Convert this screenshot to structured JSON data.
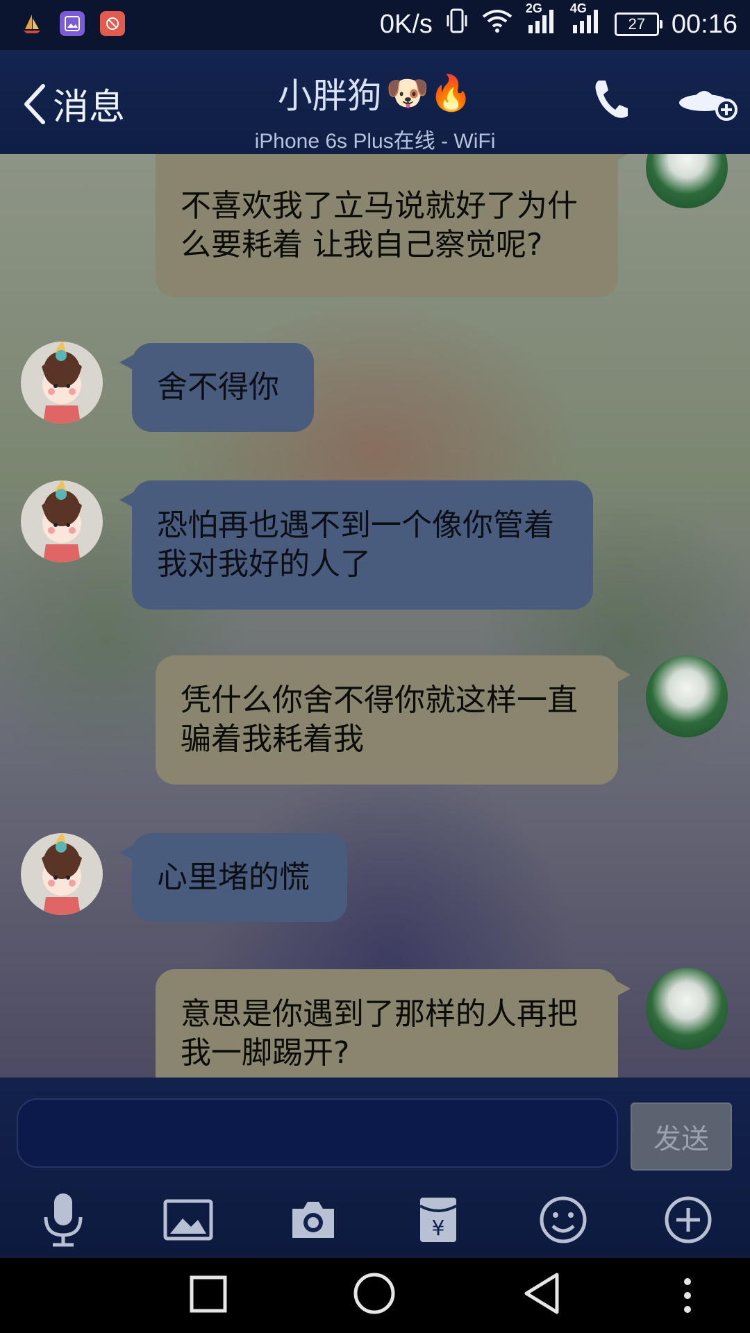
{
  "status_bar": {
    "speed": "0K/s",
    "net1": "2G",
    "net2": "4G",
    "battery": "27",
    "time": "00:16"
  },
  "header": {
    "back_label": "消息",
    "title": "小胖狗",
    "title_emojis": "🐶🔥",
    "subtitle": "iPhone 6s Plus在线 - WiFi"
  },
  "messages": [
    {
      "side": "out",
      "text": "不喜欢我了立马说就好了为什么要耗着 让我自己察觉呢?"
    },
    {
      "side": "in",
      "text": "舍不得你"
    },
    {
      "side": "in",
      "text": "恐怕再也遇不到一个像你管着我对我好的人了"
    },
    {
      "side": "out",
      "text": "凭什么你舍不得你就这样一直骗着我耗着我"
    },
    {
      "side": "in",
      "text": "心里堵的慌"
    },
    {
      "side": "out",
      "text": "意思是你遇到了那样的人再把我一脚踢开?"
    }
  ],
  "input": {
    "placeholder": "",
    "send_label": "发送"
  },
  "colors": {
    "header_bg": "#13244f",
    "incoming_bubble": "#4a5c7e",
    "outgoing_bubble": "#8a856f",
    "send_button": "#5b6270"
  }
}
